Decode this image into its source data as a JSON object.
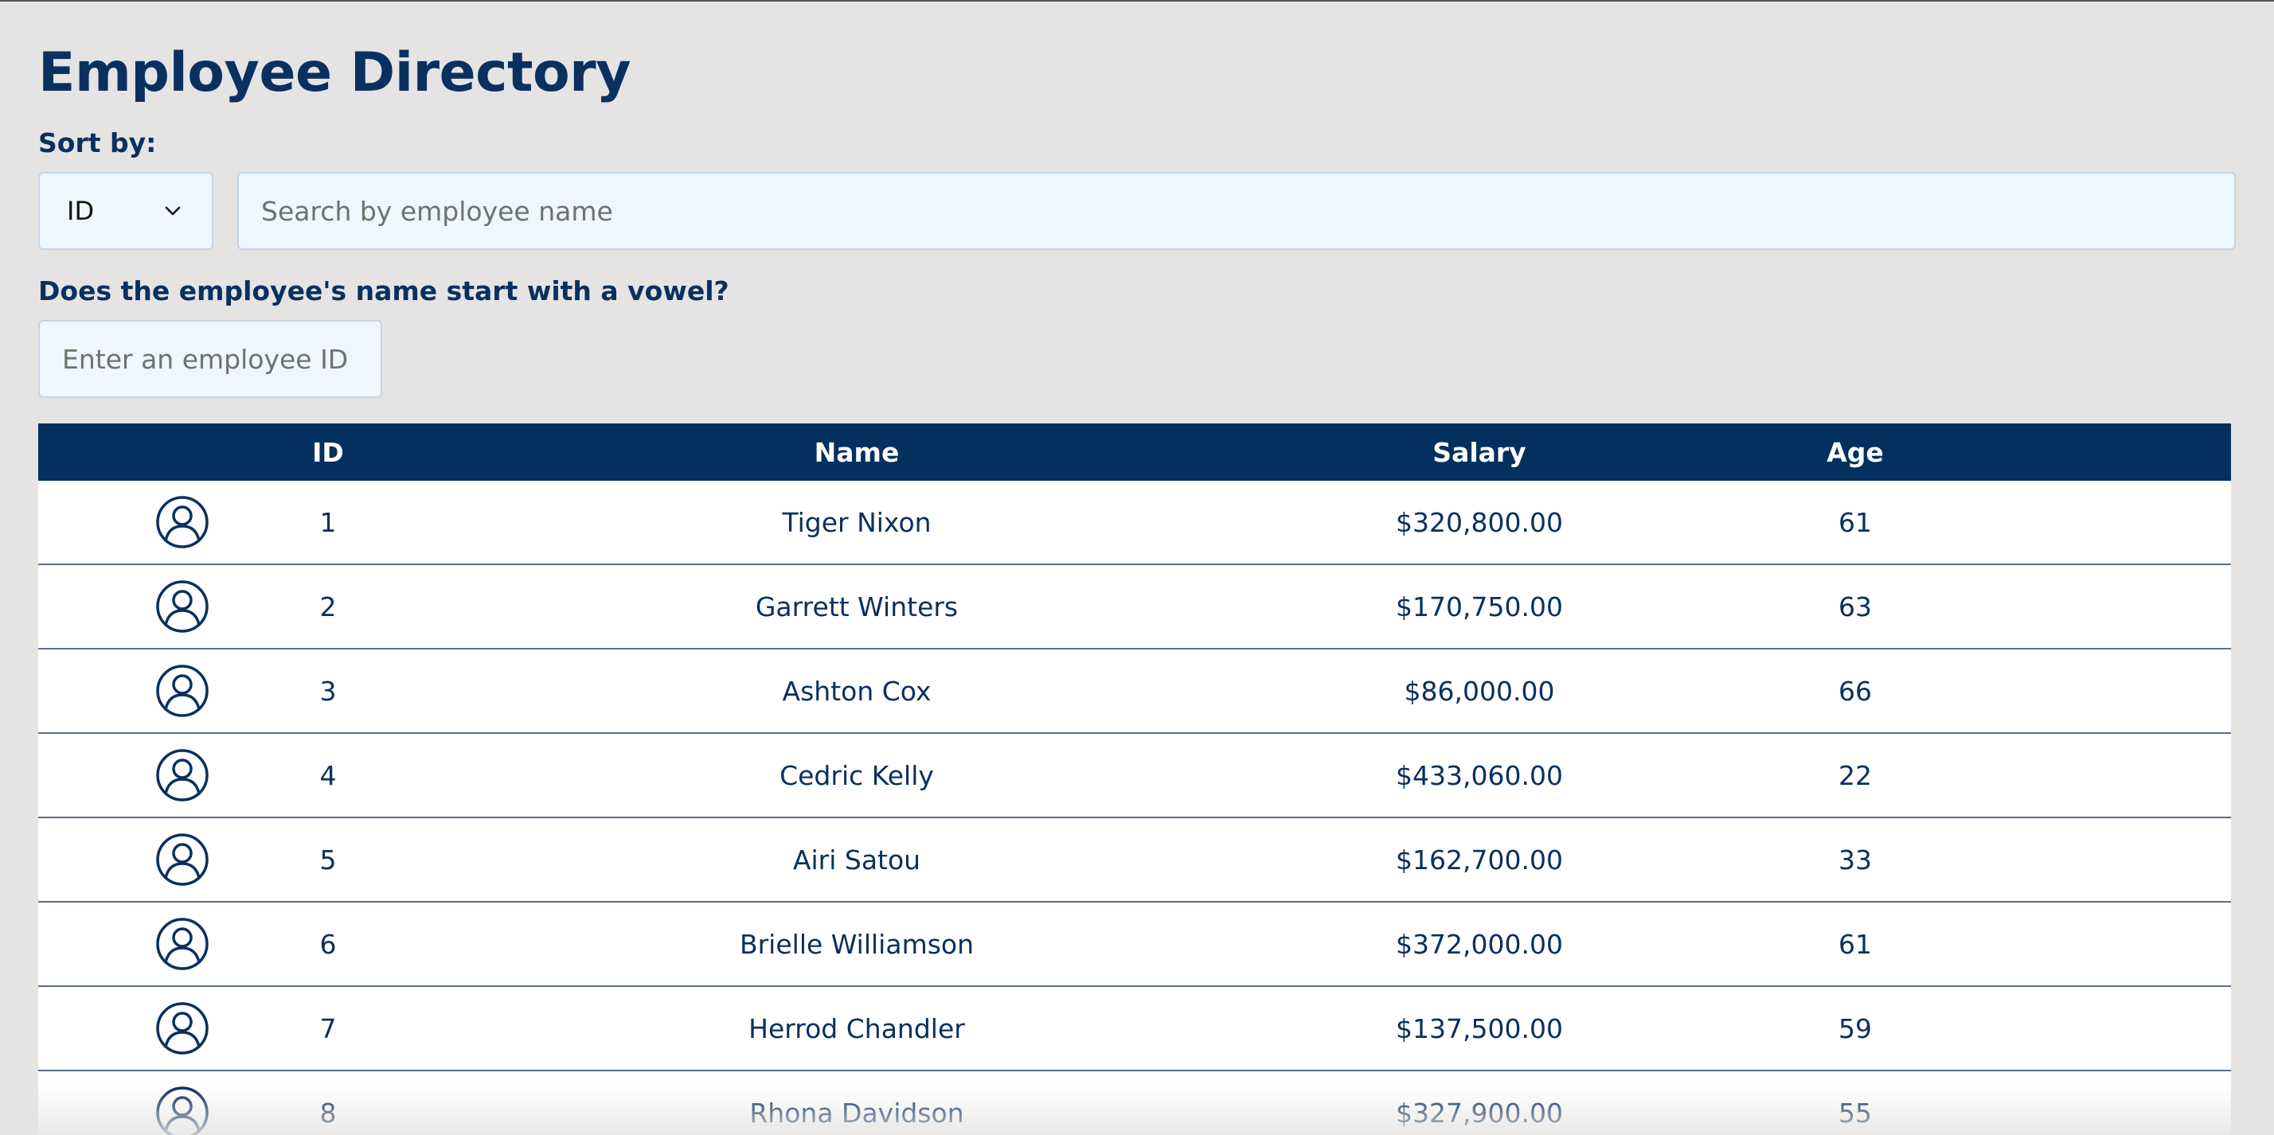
{
  "page": {
    "title": "Employee Directory"
  },
  "sort": {
    "label": "Sort by:",
    "selected": "ID",
    "icon": "chevron-down-icon"
  },
  "search": {
    "placeholder": "Search by employee name"
  },
  "vowel": {
    "label": "Does the employee's name start with a vowel?",
    "placeholder": "Enter an employee ID"
  },
  "table": {
    "headers": [
      "",
      "ID",
      "Name",
      "Salary",
      "Age"
    ],
    "rows": [
      {
        "id": "1",
        "name": "Tiger Nixon",
        "salary": "$320,800.00",
        "age": "61"
      },
      {
        "id": "2",
        "name": "Garrett Winters",
        "salary": "$170,750.00",
        "age": "63"
      },
      {
        "id": "3",
        "name": "Ashton Cox",
        "salary": "$86,000.00",
        "age": "66"
      },
      {
        "id": "4",
        "name": "Cedric Kelly",
        "salary": "$433,060.00",
        "age": "22"
      },
      {
        "id": "5",
        "name": "Airi Satou",
        "salary": "$162,700.00",
        "age": "33"
      },
      {
        "id": "6",
        "name": "Brielle Williamson",
        "salary": "$372,000.00",
        "age": "61"
      },
      {
        "id": "7",
        "name": "Herrod Chandler",
        "salary": "$137,500.00",
        "age": "59"
      },
      {
        "id": "8",
        "name": "Rhona Davidson",
        "salary": "$327,900.00",
        "age": "55"
      }
    ]
  },
  "colors": {
    "primary": "#04305f",
    "background": "#e5e4e3",
    "input_bg": "#eef6ff"
  }
}
